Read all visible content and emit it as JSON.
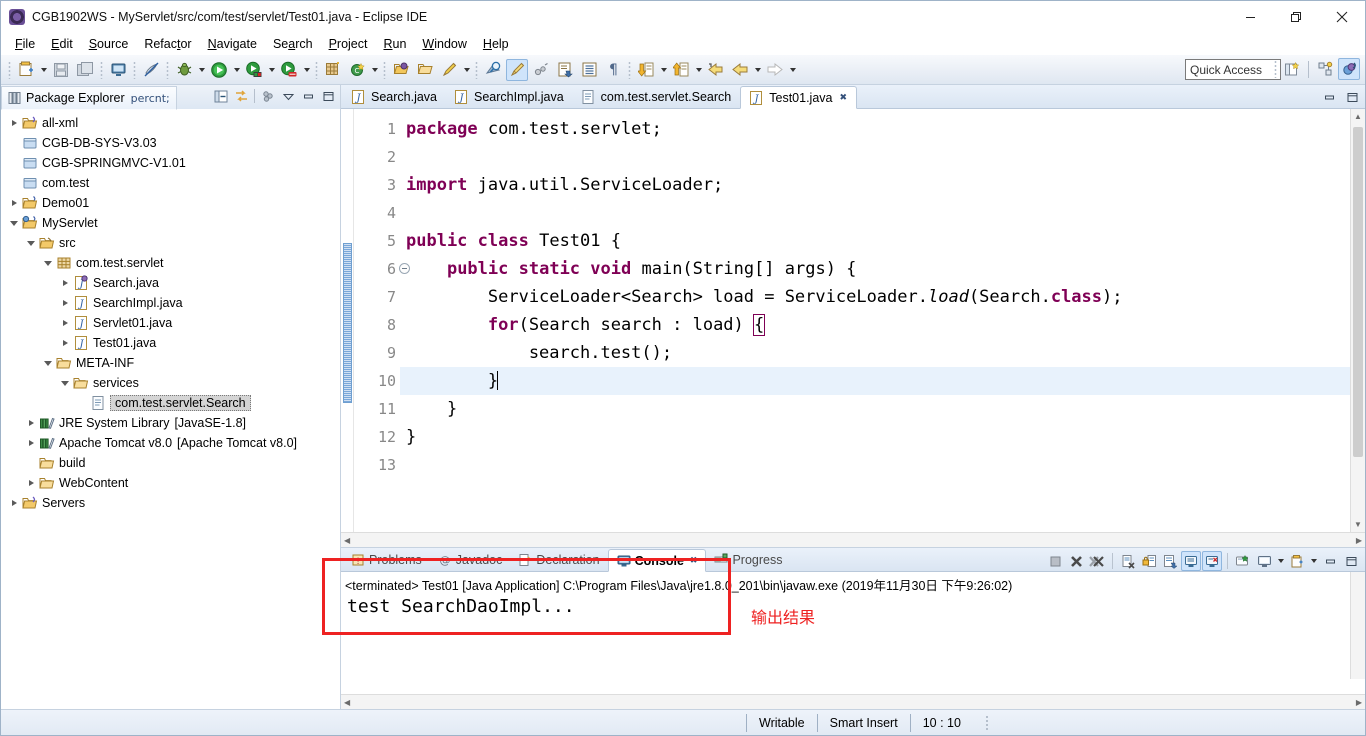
{
  "window": {
    "title": "CGB1902WS - MyServlet/src/com/test/servlet/Test01.java - Eclipse IDE",
    "minimize_label": "—",
    "maximize_label": "❐",
    "close_label": "✕"
  },
  "menubar": {
    "items": [
      {
        "label": "File",
        "mnemonic": "F"
      },
      {
        "label": "Edit",
        "mnemonic": "E"
      },
      {
        "label": "Source",
        "mnemonic": "S"
      },
      {
        "label": "Refactor",
        "mnemonic": "t"
      },
      {
        "label": "Navigate",
        "mnemonic": "N"
      },
      {
        "label": "Search",
        "mnemonic": "a"
      },
      {
        "label": "Project",
        "mnemonic": "P"
      },
      {
        "label": "Run",
        "mnemonic": "R"
      },
      {
        "label": "Window",
        "mnemonic": "W"
      },
      {
        "label": "Help",
        "mnemonic": "H"
      }
    ]
  },
  "toolbar": {
    "quick_access_placeholder": "Quick Access",
    "icons": [
      "new-wizard-icon",
      "save-icon",
      "save-all-icon",
      "print-icon",
      "toggle-mark-occurrences-icon",
      "debug-icon",
      "run-icon",
      "run-as-server-icon",
      "stop-server-icon",
      "new-java-package-icon",
      "new-java-class-icon",
      "open-type-icon",
      "open-task-icon",
      "external-tools-icon",
      "search-icon",
      "toggle-whitespace-icon",
      "next-annotation-icon",
      "previous-annotation-icon",
      "last-edit-location-icon",
      "back-icon",
      "forward-icon"
    ]
  },
  "explorer": {
    "tab_label": "Package Explorer",
    "tab_icon": "package-explorer-icon",
    "tools": [
      "collapse-all-icon",
      "link-with-editor-icon",
      "view-menu-icon",
      "minimize-icon",
      "maximize-icon"
    ],
    "tree": [
      {
        "label": "all-xml",
        "indent": 0,
        "state": "collapsed",
        "icon": "folder-project-icon"
      },
      {
        "label": "CGB-DB-SYS-V3.03",
        "indent": 0,
        "state": "leaf",
        "icon": "closed-project-icon"
      },
      {
        "label": "CGB-SPRINGMVC-V1.01",
        "indent": 0,
        "state": "leaf",
        "icon": "closed-project-icon"
      },
      {
        "label": "com.test",
        "indent": 0,
        "state": "leaf",
        "icon": "closed-project-icon"
      },
      {
        "label": "Demo01",
        "indent": 0,
        "state": "collapsed",
        "icon": "java-project-icon"
      },
      {
        "label": "MyServlet",
        "indent": 0,
        "state": "expanded",
        "icon": "web-project-icon"
      },
      {
        "label": "src",
        "indent": 1,
        "state": "expanded",
        "icon": "source-folder-icon"
      },
      {
        "label": "com.test.servlet",
        "indent": 2,
        "state": "expanded",
        "icon": "package-icon"
      },
      {
        "label": "Search.java",
        "indent": 3,
        "state": "collapsed",
        "icon": "java-interface-file-icon"
      },
      {
        "label": "SearchImpl.java",
        "indent": 3,
        "state": "collapsed",
        "icon": "java-file-icon"
      },
      {
        "label": "Servlet01.java",
        "indent": 3,
        "state": "collapsed",
        "icon": "java-file-icon"
      },
      {
        "label": "Test01.java",
        "indent": 3,
        "state": "collapsed",
        "icon": "java-file-icon"
      },
      {
        "label": "META-INF",
        "indent": 2,
        "state": "expanded",
        "icon": "folder-icon"
      },
      {
        "label": "services",
        "indent": 3,
        "state": "expanded",
        "icon": "folder-icon"
      },
      {
        "label": "com.test.servlet.Search",
        "indent": 4,
        "state": "leaf",
        "icon": "text-file-icon",
        "selected": true
      },
      {
        "label": "JRE System Library",
        "indent": 1,
        "state": "collapsed",
        "icon": "library-icon",
        "suffix": "[JavaSE-1.8]"
      },
      {
        "label": "Apache Tomcat v8.0",
        "indent": 1,
        "state": "collapsed",
        "icon": "library-icon",
        "suffix": "[Apache Tomcat v8.0]"
      },
      {
        "label": "build",
        "indent": 1,
        "state": "leaf",
        "icon": "folder-icon"
      },
      {
        "label": "WebContent",
        "indent": 1,
        "state": "collapsed",
        "icon": "folder-icon"
      },
      {
        "label": "Servers",
        "indent": 0,
        "state": "collapsed",
        "icon": "folder-project-icon"
      }
    ]
  },
  "editor": {
    "tabs": [
      {
        "label": "Search.java",
        "icon": "java-file-icon",
        "active": false
      },
      {
        "label": "SearchImpl.java",
        "icon": "java-file-icon",
        "active": false
      },
      {
        "label": "com.test.servlet.Search",
        "icon": "text-file-icon",
        "active": false
      },
      {
        "label": "Test01.java",
        "icon": "java-file-icon",
        "active": true
      }
    ],
    "tools": [
      "minimize-icon",
      "maximize-icon"
    ],
    "line_numbers": [
      "1",
      "2",
      "3",
      "4",
      "5",
      "6",
      "7",
      "8",
      "9",
      "10",
      "11",
      "12",
      "13"
    ],
    "folding_line": "6",
    "current_line": "10",
    "lines": [
      {
        "n": "1",
        "text": "package com.test.servlet;"
      },
      {
        "n": "2",
        "text": ""
      },
      {
        "n": "3",
        "text": "import java.util.ServiceLoader;"
      },
      {
        "n": "4",
        "text": ""
      },
      {
        "n": "5",
        "text": "public class Test01 {"
      },
      {
        "n": "6",
        "text": "    public static void main(String[] args) {"
      },
      {
        "n": "7",
        "text": "        ServiceLoader<Search> load = ServiceLoader.load(Search.class);"
      },
      {
        "n": "8",
        "text": "        for(Search search : load) {"
      },
      {
        "n": "9",
        "text": "            search.test();"
      },
      {
        "n": "10",
        "text": "        }"
      },
      {
        "n": "11",
        "text": "    }"
      },
      {
        "n": "12",
        "text": "}"
      },
      {
        "n": "13",
        "text": ""
      }
    ]
  },
  "console": {
    "tabs": [
      {
        "label": "Problems",
        "icon": "problems-icon",
        "active": false
      },
      {
        "label": "Javadoc",
        "icon": "javadoc-icon",
        "active": false
      },
      {
        "label": "Declaration",
        "icon": "declaration-icon",
        "active": false
      },
      {
        "label": "Console",
        "icon": "console-icon",
        "active": true
      },
      {
        "label": "Progress",
        "icon": "progress-icon",
        "active": false
      }
    ],
    "tools": [
      "terminate-icon",
      "remove-launch-icon",
      "remove-all-launches-icon",
      "clear-console-icon",
      "scroll-lock-icon",
      "word-wrap-icon",
      "show-console-on-output-icon",
      "show-console-on-error-icon",
      "pin-console-icon",
      "display-selected-console-icon",
      "open-console-icon",
      "minimize-icon",
      "maximize-icon"
    ],
    "header": "<terminated> Test01 [Java Application] C:\\Program Files\\Java\\jre1.8.0_201\\bin\\javaw.exe (2019年11月30日 下午9:26:02)",
    "output": "test SearchDaoImpl..."
  },
  "annotation": {
    "label": "输出结果",
    "color": "#ee2222"
  },
  "statusbar": {
    "writable": "Writable",
    "insert_mode": "Smart Insert",
    "position": "10 : 10"
  }
}
